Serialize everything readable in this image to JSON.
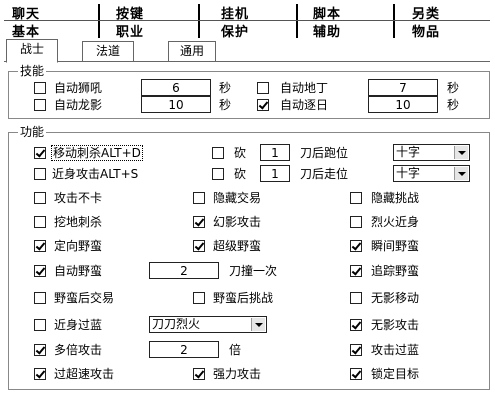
{
  "top_tabs": {
    "row1": [
      "聊天",
      "按键",
      "挂机",
      "脚本",
      "另类"
    ],
    "row2": [
      "基本",
      "职业",
      "保护",
      "辅助",
      "物品"
    ]
  },
  "sub_tabs": [
    "战士",
    "法道",
    "通用"
  ],
  "skills": {
    "title": "技能",
    "items": [
      {
        "label": "自动狮吼",
        "checked": false,
        "value": "6",
        "unit": "秒"
      },
      {
        "label": "自动地丁",
        "checked": false,
        "value": "7",
        "unit": "秒"
      },
      {
        "label": "自动龙影",
        "checked": false,
        "value": "10",
        "unit": "秒"
      },
      {
        "label": "自动逐日",
        "checked": true,
        "value": "10",
        "unit": "秒"
      }
    ]
  },
  "functions": {
    "title": "功能",
    "row1": {
      "label": "移动刺杀ALT+D",
      "checked": true,
      "cut_label": "砍",
      "cut_checked": false,
      "cut_value": "1",
      "after": "刀后跑位",
      "pos_option": "十字"
    },
    "row2": {
      "label": "近身攻击ALT+S",
      "checked": false,
      "cut_label": "砍",
      "cut_checked": false,
      "cut_value": "1",
      "after": "刀后走位",
      "pos_option": "十字"
    },
    "r3": [
      {
        "label": "攻击不卡",
        "checked": false
      },
      {
        "label": "隐藏交易",
        "checked": false
      },
      {
        "label": "隐藏挑战",
        "checked": false
      }
    ],
    "r4": [
      {
        "label": "挖地刺杀",
        "checked": false
      },
      {
        "label": "幻影攻击",
        "checked": true
      },
      {
        "label": "烈火近身",
        "checked": false
      }
    ],
    "r5": [
      {
        "label": "定向野蛮",
        "checked": true
      },
      {
        "label": "超级野蛮",
        "checked": true
      },
      {
        "label": "瞬间野蛮",
        "checked": true
      }
    ],
    "r6": {
      "label": "自动野蛮",
      "checked": true,
      "value": "2",
      "suffix": "刀撞一次",
      "right": {
        "label": "追踪野蛮",
        "checked": true
      }
    },
    "r7": [
      {
        "label": "野蛮后交易",
        "checked": false
      },
      {
        "label": "野蛮后挑战",
        "checked": false
      },
      {
        "label": "无影移动",
        "checked": false
      }
    ],
    "r8": {
      "label": "近身过蓝",
      "checked": false,
      "option": "刀刀烈火",
      "right": {
        "label": "无影攻击",
        "checked": true
      }
    },
    "r9": {
      "label": "多倍攻击",
      "checked": true,
      "value": "2",
      "suffix": "倍",
      "right": {
        "label": "攻击过蓝",
        "checked": true
      }
    },
    "r10": [
      {
        "label": "过超速攻击",
        "checked": true
      },
      {
        "label": "强力攻击",
        "checked": true
      },
      {
        "label": "锁定目标",
        "checked": true
      }
    ]
  }
}
